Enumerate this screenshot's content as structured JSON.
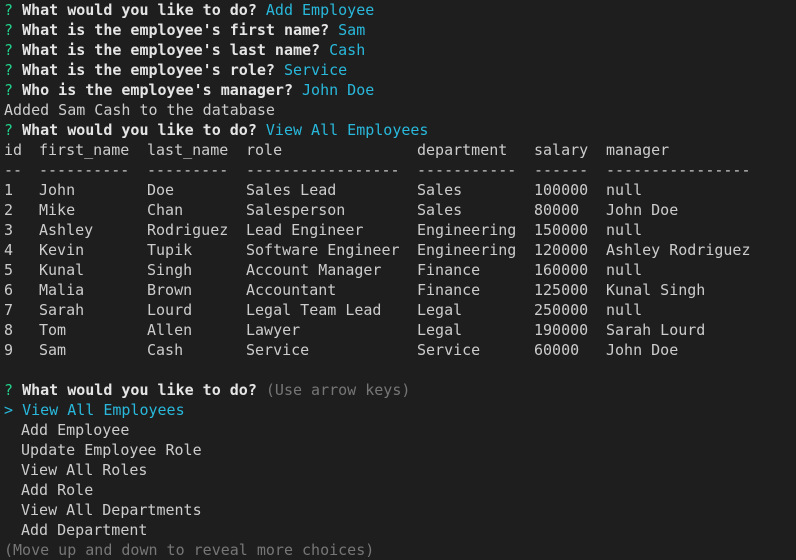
{
  "prompts": [
    {
      "question": "What would you like to do?",
      "answer": "Add Employee"
    },
    {
      "question": "What is the employee's first name?",
      "answer": "Sam"
    },
    {
      "question": "What is the employee's last name?",
      "answer": "Cash"
    },
    {
      "question": "What is the employee's role?",
      "answer": "Service"
    },
    {
      "question": "Who is the employee's manager?",
      "answer": "John Doe"
    }
  ],
  "prompt_mark": "?",
  "added_message": "Added Sam Cash to the database",
  "view_prompt": {
    "question": "What would you like to do?",
    "answer": "View All Employees"
  },
  "table": {
    "headers": [
      "id",
      "first_name",
      "last_name",
      "role",
      "department",
      "salary",
      "manager"
    ],
    "separators": [
      "--",
      "----------",
      "---------",
      "-----------------",
      "-----------",
      "------",
      "----------------"
    ],
    "rows": [
      [
        "1",
        "John",
        "Doe",
        "Sales Lead",
        "Sales",
        "100000",
        "null"
      ],
      [
        "2",
        "Mike",
        "Chan",
        "Salesperson",
        "Sales",
        "80000",
        "John Doe"
      ],
      [
        "3",
        "Ashley",
        "Rodriguez",
        "Lead Engineer",
        "Engineering",
        "150000",
        "null"
      ],
      [
        "4",
        "Kevin",
        "Tupik",
        "Software Engineer",
        "Engineering",
        "120000",
        "Ashley Rodriguez"
      ],
      [
        "5",
        "Kunal",
        "Singh",
        "Account Manager",
        "Finance",
        "160000",
        "null"
      ],
      [
        "6",
        "Malia",
        "Brown",
        "Accountant",
        "Finance",
        "125000",
        "Kunal Singh"
      ],
      [
        "7",
        "Sarah",
        "Lourd",
        "Legal Team Lead",
        "Legal",
        "250000",
        "null"
      ],
      [
        "8",
        "Tom",
        "Allen",
        "Lawyer",
        "Legal",
        "190000",
        "Sarah Lourd"
      ],
      [
        "9",
        "Sam",
        "Cash",
        "Service",
        "Service",
        "60000",
        "John Doe"
      ]
    ]
  },
  "menu_prompt": {
    "question": "What would you like to do?",
    "hint": "(Use arrow keys)"
  },
  "menu": {
    "pointer": ">",
    "selected": "View All Employees",
    "items": [
      "Add Employee",
      "Update Employee Role",
      "View All Roles",
      "Add Role",
      "View All Departments",
      "Add Department"
    ]
  },
  "footer_hint": "(Move up and down to reveal more choices)",
  "colors": {
    "background": "#1e1e1e",
    "text": "#cccccc",
    "prompt_mark": "#23d18b",
    "answer": "#29b8db",
    "dim": "#767676"
  }
}
